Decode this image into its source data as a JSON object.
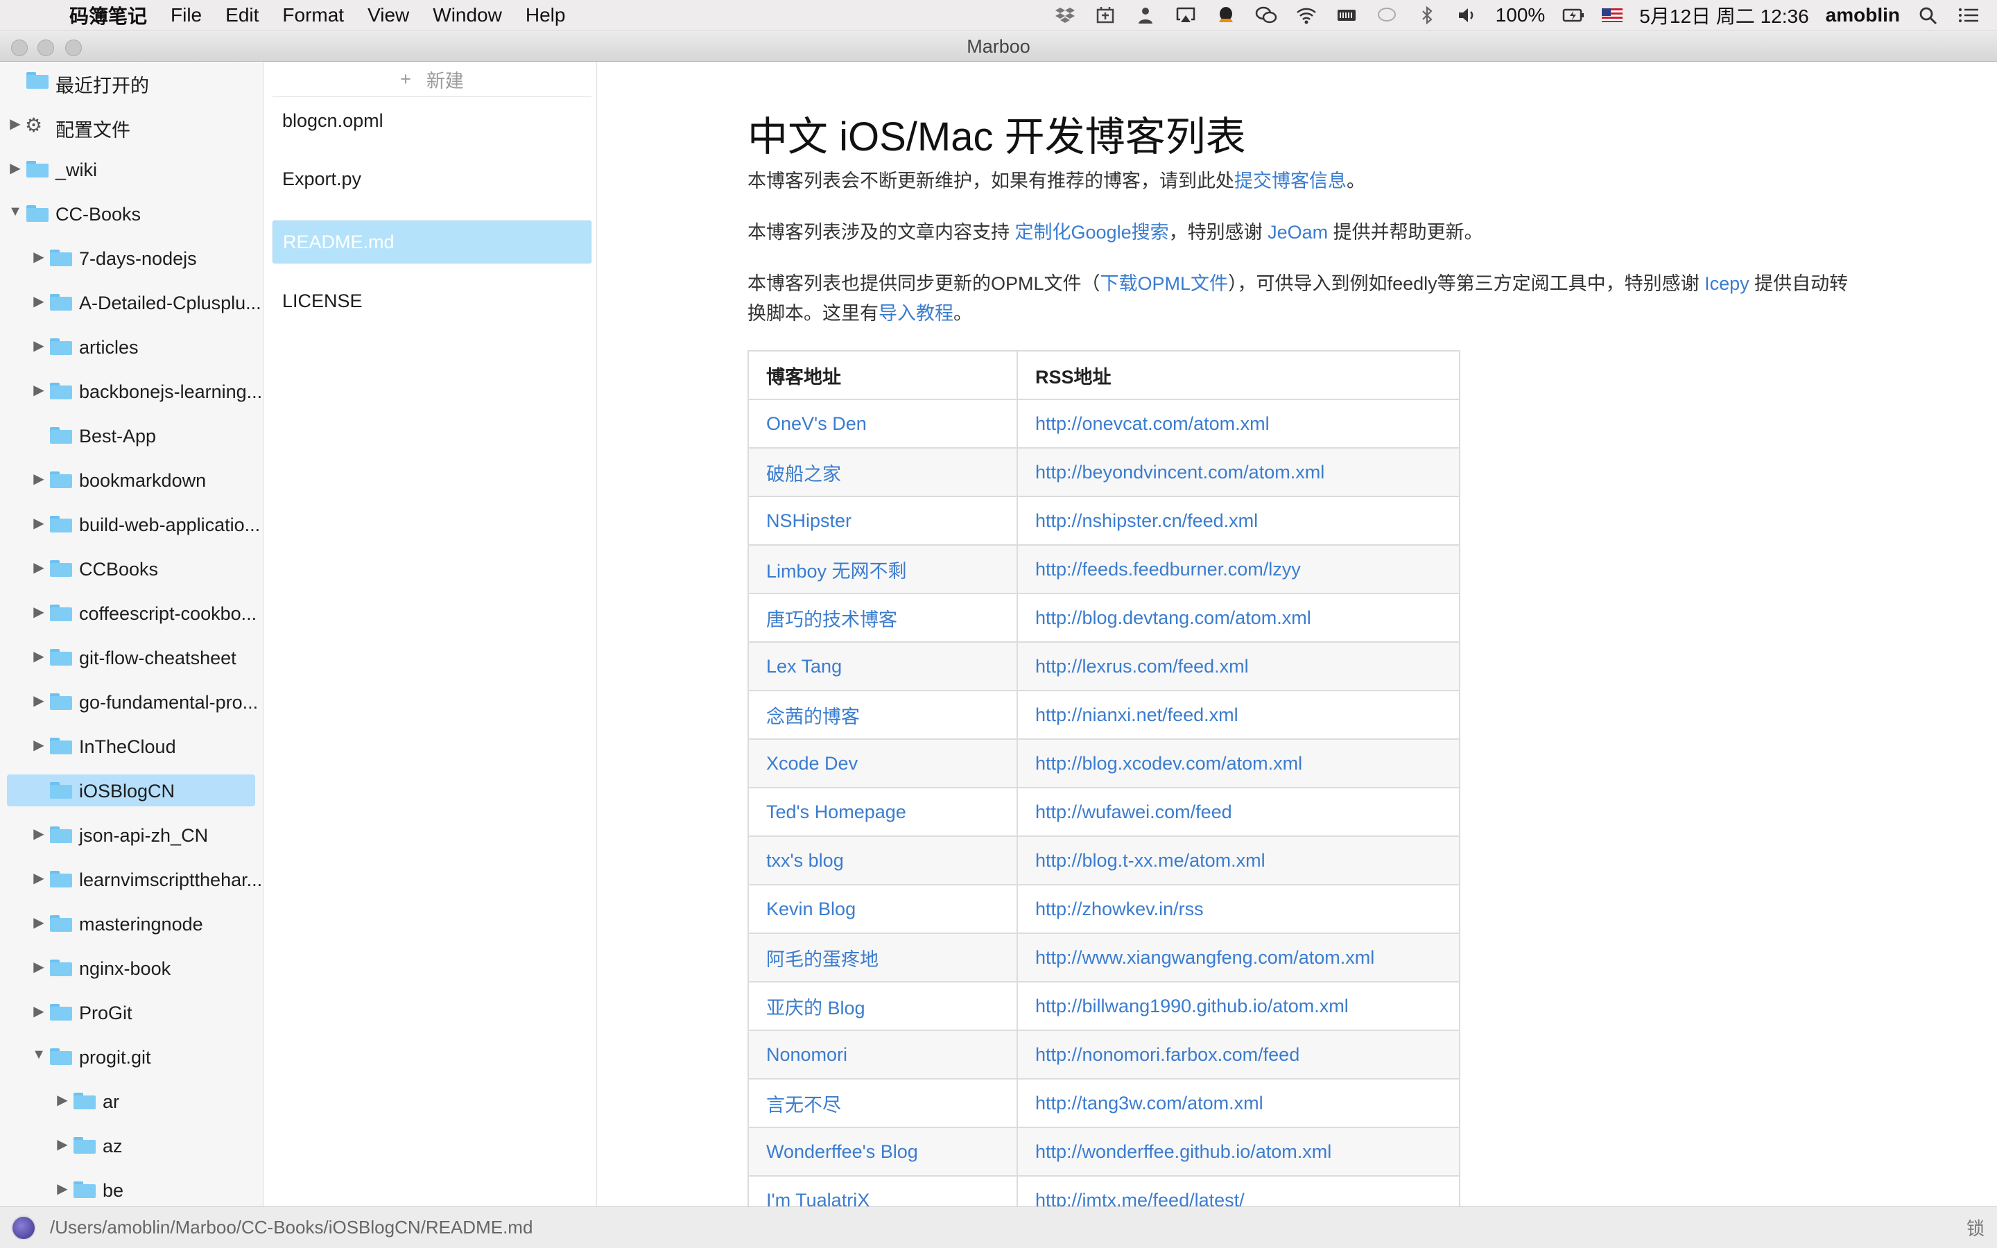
{
  "menubar": {
    "app_name": "码簿笔记",
    "menus": [
      "File",
      "Edit",
      "Format",
      "View",
      "Window",
      "Help"
    ],
    "battery": "100%",
    "datetime": "5月12日 周二 12:36",
    "user": "amoblin"
  },
  "window": {
    "title": "Marboo"
  },
  "sidebar": {
    "items": [
      {
        "label": "最近打开的",
        "icon": "folder-icon",
        "arrow": ""
      },
      {
        "label": "配置文件",
        "icon": "gear-icon",
        "arrow": "▶"
      },
      {
        "label": "_wiki",
        "icon": "folder-icon",
        "arrow": "▶"
      },
      {
        "label": "CC-Books",
        "icon": "folder-icon",
        "arrow": "▼"
      },
      {
        "label": "7-days-nodejs",
        "icon": "folder-icon",
        "arrow": "▶"
      },
      {
        "label": "A-Detailed-Cplusplu...",
        "icon": "folder-icon",
        "arrow": "▶"
      },
      {
        "label": "articles",
        "icon": "folder-icon",
        "arrow": "▶"
      },
      {
        "label": "backbonejs-learning...",
        "icon": "folder-icon",
        "arrow": "▶"
      },
      {
        "label": "Best-App",
        "icon": "folder-icon",
        "arrow": ""
      },
      {
        "label": "bookmarkdown",
        "icon": "folder-icon",
        "arrow": "▶"
      },
      {
        "label": "build-web-applicatio...",
        "icon": "folder-icon",
        "arrow": "▶"
      },
      {
        "label": "CCBooks",
        "icon": "folder-icon",
        "arrow": "▶"
      },
      {
        "label": "coffeescript-cookbo...",
        "icon": "folder-icon",
        "arrow": "▶"
      },
      {
        "label": "git-flow-cheatsheet",
        "icon": "folder-icon",
        "arrow": "▶"
      },
      {
        "label": "go-fundamental-pro...",
        "icon": "folder-icon",
        "arrow": "▶"
      },
      {
        "label": "InTheCloud",
        "icon": "folder-icon",
        "arrow": "▶"
      },
      {
        "label": "iOSBlogCN",
        "icon": "folder-icon",
        "arrow": "",
        "selected": true
      },
      {
        "label": "json-api-zh_CN",
        "icon": "folder-icon",
        "arrow": "▶"
      },
      {
        "label": "learnvimscriptthehar...",
        "icon": "folder-icon",
        "arrow": "▶"
      },
      {
        "label": "masteringnode",
        "icon": "folder-icon",
        "arrow": "▶"
      },
      {
        "label": "nginx-book",
        "icon": "folder-icon",
        "arrow": "▶"
      },
      {
        "label": "ProGit",
        "icon": "folder-icon",
        "arrow": "▶"
      },
      {
        "label": "progit.git",
        "icon": "folder-icon",
        "arrow": "▼"
      },
      {
        "label": "ar",
        "icon": "folder-icon",
        "arrow": "▶"
      },
      {
        "label": "az",
        "icon": "folder-icon",
        "arrow": "▶"
      },
      {
        "label": "be",
        "icon": "folder-icon",
        "arrow": "▶"
      }
    ]
  },
  "filelist": {
    "new_label": "新建",
    "files": [
      "blogcn.opml",
      "Export.py",
      "README.md",
      "LICENSE"
    ],
    "selected": "README.md"
  },
  "doc": {
    "title": "中文 iOS/Mac 开发博客列表",
    "p1": {
      "text": "本博客列表会不断更新维护，如果有推荐的博客，请到此处",
      "link": "提交博客信息",
      "end": "。"
    },
    "p2": {
      "text1": "本博客列表涉及的文章内容支持 ",
      "link1": "定制化Google搜索",
      "text2": "，特别感谢 ",
      "link2": "JeOam",
      "text3": " 提供并帮助更新。"
    },
    "p3": {
      "text1": "本博客列表也提供同步更新的OPML文件（",
      "link1": "下载OPML文件",
      "text2": "），可供导入到例如feedly等第三方定阅工具中，特别感谢 ",
      "link2": "Icepy",
      "text3": " 提供自动转换脚本。这里有",
      "link3": "导入教程",
      "text4": "。"
    },
    "table_headers": [
      "博客地址",
      "RSS地址"
    ],
    "rows": [
      {
        "blog": "OneV's Den",
        "rss": "http://onevcat.com/atom.xml"
      },
      {
        "blog": "破船之家",
        "rss": "http://beyondvincent.com/atom.xml"
      },
      {
        "blog": "NSHipster",
        "rss": "http://nshipster.cn/feed.xml"
      },
      {
        "blog": "Limboy 无网不剩",
        "rss": "http://feeds.feedburner.com/lzyy"
      },
      {
        "blog": "唐巧的技术博客",
        "rss": "http://blog.devtang.com/atom.xml"
      },
      {
        "blog": "Lex Tang",
        "rss": "http://lexrus.com/feed.xml"
      },
      {
        "blog": "念茜的博客",
        "rss": "http://nianxi.net/feed.xml"
      },
      {
        "blog": "Xcode Dev",
        "rss": "http://blog.xcodev.com/atom.xml"
      },
      {
        "blog": "Ted's Homepage",
        "rss": "http://wufawei.com/feed"
      },
      {
        "blog": "txx's blog",
        "rss": "http://blog.t-xx.me/atom.xml"
      },
      {
        "blog": "Kevin Blog",
        "rss": "http://zhowkev.in/rss"
      },
      {
        "blog": "阿毛的蛋疼地",
        "rss": "http://www.xiangwangfeng.com/atom.xml"
      },
      {
        "blog": "亚庆的 Blog",
        "rss": "http://billwang1990.github.io/atom.xml"
      },
      {
        "blog": "Nonomori",
        "rss": "http://nonomori.farbox.com/feed"
      },
      {
        "blog": "言无不尽",
        "rss": "http://tang3w.com/atom.xml"
      },
      {
        "blog": "Wonderffee's Blog",
        "rss": "http://wonderffee.github.io/atom.xml"
      },
      {
        "blog": "I'm TualatriX",
        "rss": "http://imtx.me/feed/latest/"
      }
    ]
  },
  "statusbar": {
    "path": "/Users/amoblin/Marboo/CC-Books/iOSBlogCN/README.md",
    "lock_label": "锁"
  },
  "colors": {
    "accent": "#3a7ccf",
    "selection": "#b5dffa",
    "folder": "#7fcdf5"
  }
}
